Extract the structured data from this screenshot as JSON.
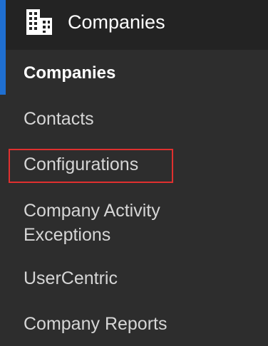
{
  "header": {
    "icon": "building-icon",
    "title": "Companies",
    "accent_color": "#1f6fd1"
  },
  "nav": {
    "items": [
      {
        "label": "Companies",
        "active": true
      },
      {
        "label": "Contacts",
        "active": false
      },
      {
        "label": "Configurations",
        "active": false,
        "highlighted": true
      },
      {
        "label_lines": [
          "Company Activity",
          "Exceptions"
        ],
        "active": false
      },
      {
        "label": "UserCentric",
        "active": false
      },
      {
        "label": "Company Reports",
        "active": false
      }
    ]
  },
  "colors": {
    "background": "#2d2d2d",
    "header_background": "#232323",
    "highlight_border": "#e0302f"
  }
}
